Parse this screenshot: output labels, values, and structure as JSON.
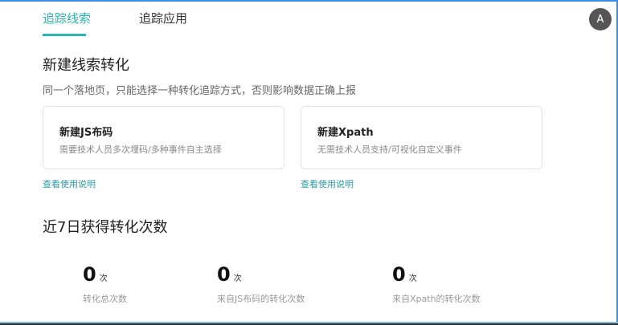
{
  "tabs": [
    {
      "label": "追踪线索"
    },
    {
      "label": "追踪应用"
    }
  ],
  "ocr_label": "A",
  "section_title": "新建线索转化",
  "note": "同一个落地页，只能选择一种转化追踪方式，否则影响数据正确上报",
  "cards": [
    {
      "title": "新建JS布码",
      "desc": "需要技术人员多次埋码/多种事件自主选择",
      "link": "查看使用说明"
    },
    {
      "title": "新建Xpath",
      "desc": "无需技术人员支持/可视化自定义事件",
      "link": "查看使用说明"
    }
  ],
  "stats_title": "近7日获得转化次数",
  "stats": [
    {
      "value": "0",
      "unit": "次",
      "label": "转化总次数"
    },
    {
      "value": "0",
      "unit": "次",
      "label": "来自JS布码的转化次数"
    },
    {
      "value": "0",
      "unit": "次",
      "label": "来自Xpath的转化次数"
    }
  ]
}
